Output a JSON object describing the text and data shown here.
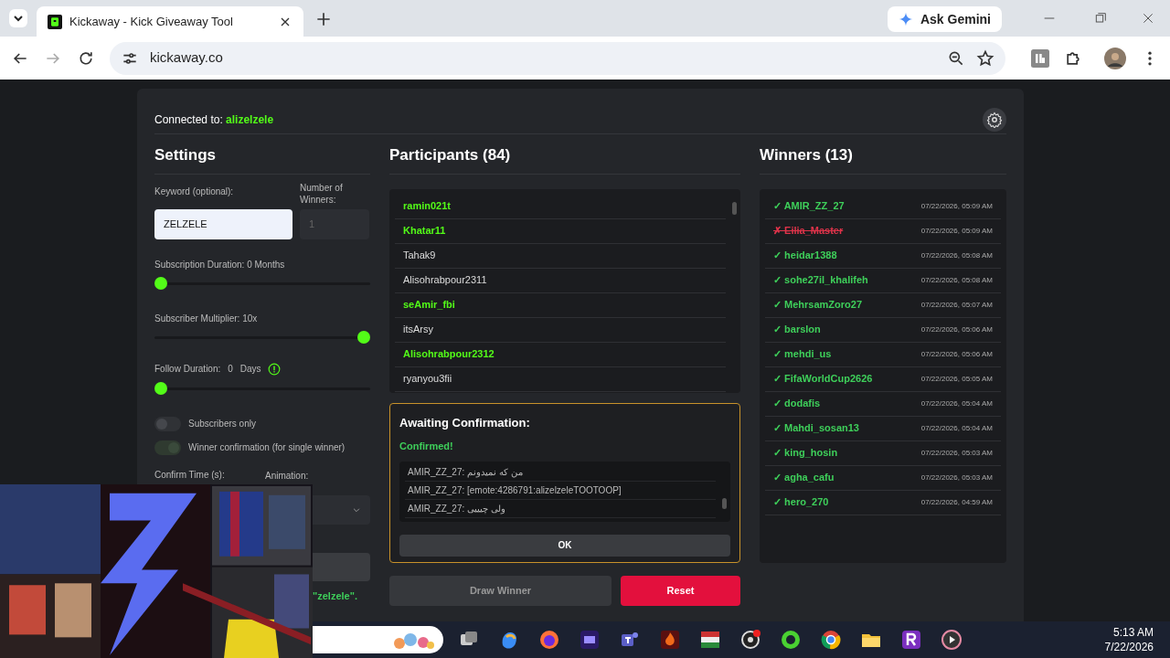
{
  "browser": {
    "tab_title": "Kickaway - Kick Giveaway Tool",
    "url": "kickaway.co",
    "gemini_button": "Ask Gemini"
  },
  "connection": {
    "label": "Connected to:",
    "user": "alizelzele"
  },
  "settings": {
    "title": "Settings",
    "keyword_label": "Keyword (optional):",
    "keyword_value": "ZELZELE",
    "winners_label": "Number of Winners:",
    "winners_placeholder": "1",
    "sliders": [
      {
        "label": "Subscription Duration: 0 Months",
        "level": 0
      },
      {
        "label": "Subscriber Multiplier: 10x",
        "level": 1
      }
    ],
    "follow": {
      "label": "Follow Duration:",
      "value": "0",
      "unit": "Days",
      "level": 0
    },
    "toggles": [
      {
        "label": "Subscribers only",
        "on": false
      },
      {
        "label": "Winner confirmation (for single winner)",
        "on": true
      }
    ],
    "confirm_time_label": "Confirm Time (s):",
    "animation_label": "Animation:",
    "note": "\"zelzele\"."
  },
  "participants": {
    "title": "Participants (84)",
    "items": [
      {
        "name": "ramin021t",
        "highlighted": true
      },
      {
        "name": "Khatar11",
        "highlighted": true
      },
      {
        "name": "Tahak9",
        "highlighted": false
      },
      {
        "name": "Alisohrabpour2311",
        "highlighted": false
      },
      {
        "name": "seAmir_fbi",
        "highlighted": true
      },
      {
        "name": "itsArsy",
        "highlighted": false
      },
      {
        "name": "Alisohrabpour2312",
        "highlighted": true
      },
      {
        "name": "ryanyou3fii",
        "highlighted": false
      }
    ]
  },
  "confirmation": {
    "title": "Awaiting Confirmation:",
    "status": "Confirmed!",
    "messages": [
      "AMIR_ZZ_27: من که نمیدونم",
      "AMIR_ZZ_27: [emote:4286791:alizelzeleTOOTOOP]",
      "AMIR_ZZ_27: ولی چیییی"
    ],
    "ok_button": "OK"
  },
  "actions": {
    "draw_button": "Draw Winner",
    "reset_button": "Reset"
  },
  "winners": {
    "title": "Winners (13)",
    "items": [
      {
        "mark": "✓",
        "name": "AMIR_ZZ_27",
        "time": "07/22/2026, 05:09 AM",
        "confirmed": true
      },
      {
        "mark": "✗",
        "name": "Eilia_Master",
        "time": "07/22/2026, 05:09 AM",
        "confirmed": false
      },
      {
        "mark": "✓",
        "name": "heidar1388",
        "time": "07/22/2026, 05:08 AM",
        "confirmed": true
      },
      {
        "mark": "✓",
        "name": "sohe27il_khalifeh",
        "time": "07/22/2026, 05:08 AM",
        "confirmed": true
      },
      {
        "mark": "✓",
        "name": "MehrsamZoro27",
        "time": "07/22/2026, 05:07 AM",
        "confirmed": true
      },
      {
        "mark": "✓",
        "name": "barslon",
        "time": "07/22/2026, 05:06 AM",
        "confirmed": true
      },
      {
        "mark": "✓",
        "name": "mehdi_us",
        "time": "07/22/2026, 05:06 AM",
        "confirmed": true
      },
      {
        "mark": "✓",
        "name": "FifaWorldCup2626",
        "time": "07/22/2026, 05:05 AM",
        "confirmed": true
      },
      {
        "mark": "✓",
        "name": "dodafis",
        "time": "07/22/2026, 05:04 AM",
        "confirmed": true
      },
      {
        "mark": "✓",
        "name": "Mahdi_sosan13",
        "time": "07/22/2026, 05:04 AM",
        "confirmed": true
      },
      {
        "mark": "✓",
        "name": "king_hosin",
        "time": "07/22/2026, 05:03 AM",
        "confirmed": true
      },
      {
        "mark": "✓",
        "name": "agha_cafu",
        "time": "07/22/2026, 05:03 AM",
        "confirmed": true
      },
      {
        "mark": "✓",
        "name": "hero_270",
        "time": "07/22/2026, 04:59 AM",
        "confirmed": true
      }
    ]
  },
  "taskbar": {
    "time": "5:13 AM",
    "date": "7/22/2026"
  }
}
